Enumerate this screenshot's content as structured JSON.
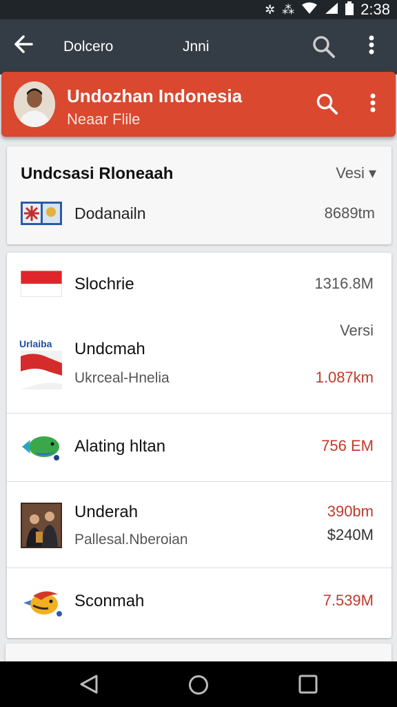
{
  "status_bar": {
    "time": "2:38",
    "icons": [
      "bluetooth-icon",
      "vibrate-icon",
      "wifi-icon",
      "signal-icon",
      "battery-icon"
    ]
  },
  "app_bar": {
    "title_left": "Dolcero",
    "title_center": "Jnni",
    "back_icon": "back-arrow-icon",
    "search_icon": "search-icon",
    "menu_icon": "more-vert-icon"
  },
  "header": {
    "title": "Undozhan Indonesia",
    "subtitle": "Neaar Flile",
    "accent_color": "#d9482f"
  },
  "section": {
    "title": "Undcsasi Rloneaah",
    "version_label": "Vesi ▾",
    "item": {
      "name": "Dodanailn",
      "size": "8689tm"
    }
  },
  "list": {
    "items": [
      {
        "name": "Slochrie",
        "subtitle": "",
        "version": "",
        "size": "1316.8M",
        "size_extra": "",
        "icon": "flag-icon"
      },
      {
        "name": "Undcmah",
        "subtitle": "Ukrceal-Hnelia",
        "version": "Versi",
        "size": "1.087km",
        "size_extra": "",
        "icon_label": "Urlaiba",
        "icon": "flag-wave-icon"
      },
      {
        "name": "Alating hltan",
        "subtitle": "",
        "version": "",
        "size": "756 EM",
        "size_extra": "",
        "icon": "fish-icon"
      },
      {
        "name": "Underah",
        "subtitle": "Pallesal.Nberoian",
        "version": "",
        "size": "390bm",
        "size_extra": "$240M",
        "icon": "people-photo-icon"
      },
      {
        "name": "Sconmah",
        "subtitle": "",
        "version": "",
        "size": "7.539M",
        "size_extra": "",
        "icon": "bird-icon"
      }
    ]
  },
  "nav_bar": {
    "back": "nav-back-icon",
    "home": "nav-home-icon",
    "recents": "nav-recents-icon"
  }
}
